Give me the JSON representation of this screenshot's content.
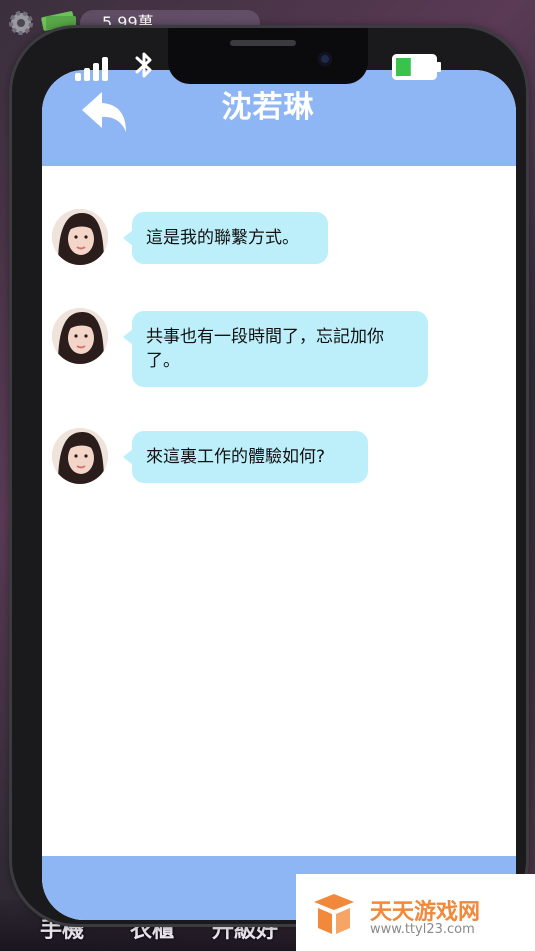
{
  "hud": {
    "money": "5.99萬",
    "icons": [
      "gear-icon",
      "money-icon"
    ]
  },
  "bottom_tabs": [
    "手機",
    "衣櫃",
    "升級好"
  ],
  "phone": {
    "status_icons": [
      "signal-icon",
      "bluetooth-icon",
      "battery-icon"
    ],
    "battery_level": 0.4,
    "contact_name": "沈若琳",
    "messages": [
      {
        "sender": "沈若琳",
        "text": "這是我的聯繫方式。"
      },
      {
        "sender": "沈若琳",
        "text": "共事也有一段時間了，忘記加你了。"
      },
      {
        "sender": "沈若琳",
        "text": "來這裏工作的體驗如何?"
      }
    ]
  },
  "watermark": {
    "title": "天天游戏网",
    "url": "www.ttyl23.com"
  },
  "colors": {
    "header": "#8fb6f4",
    "bubble": "#bdeffb",
    "watermark_accent": "#f1883a"
  }
}
